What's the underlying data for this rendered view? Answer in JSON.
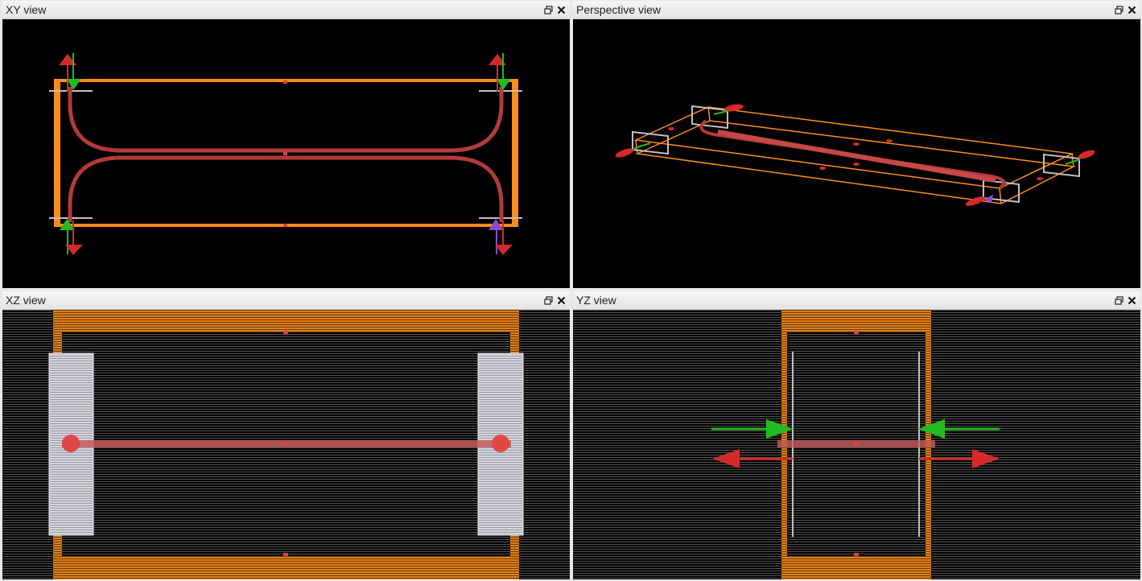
{
  "panes": {
    "xy": {
      "title": "XY view"
    },
    "perspective": {
      "title": "Perspective view"
    },
    "xz": {
      "title": "XZ view"
    },
    "yz": {
      "title": "YZ view"
    }
  },
  "icons": {
    "restore": "restore-window-icon",
    "close": "close-icon"
  },
  "colors": {
    "boundary": "#ff8c1a",
    "waveguide": "#b33a3a",
    "port_box": "#c0c0c0",
    "arrow_red": "#d42a2a",
    "arrow_green": "#22bb22",
    "arrow_purple": "#8a4ad0",
    "background": "#000000",
    "mesh_line": "#555555"
  }
}
